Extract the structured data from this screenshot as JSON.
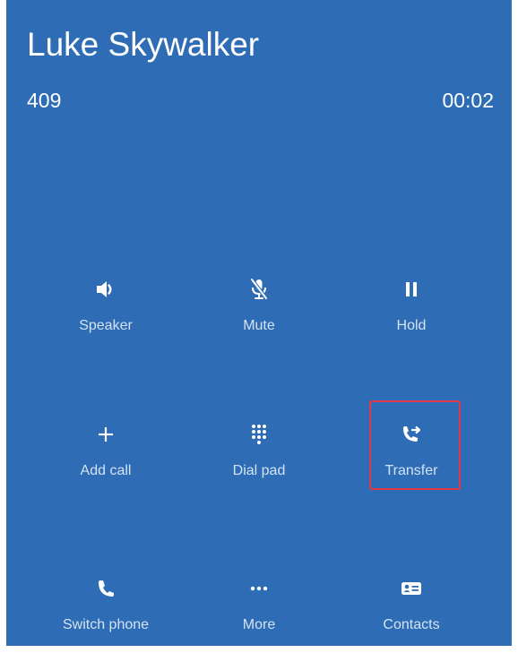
{
  "call": {
    "caller_name": "Luke Skywalker",
    "caller_number": "409",
    "timer": "00:02"
  },
  "actions": [
    {
      "id": "speaker",
      "label": "Speaker",
      "icon": "speaker-icon"
    },
    {
      "id": "mute",
      "label": "Mute",
      "icon": "microphone-off-icon"
    },
    {
      "id": "hold",
      "label": "Hold",
      "icon": "pause-icon"
    },
    {
      "id": "add-call",
      "label": "Add call",
      "icon": "plus-icon"
    },
    {
      "id": "dial-pad",
      "label": "Dial pad",
      "icon": "dialpad-icon"
    },
    {
      "id": "transfer",
      "label": "Transfer",
      "icon": "phone-forward-icon"
    },
    {
      "id": "switch-phone",
      "label": "Switch phone",
      "icon": "phone-icon"
    },
    {
      "id": "more",
      "label": "More",
      "icon": "more-horizontal-icon"
    },
    {
      "id": "contacts",
      "label": "Contacts",
      "icon": "contact-card-icon"
    }
  ],
  "colors": {
    "background": "#2e6db5",
    "text": "#ffffff",
    "label_text": "#d4e2f3",
    "highlight": "#e2384a"
  }
}
